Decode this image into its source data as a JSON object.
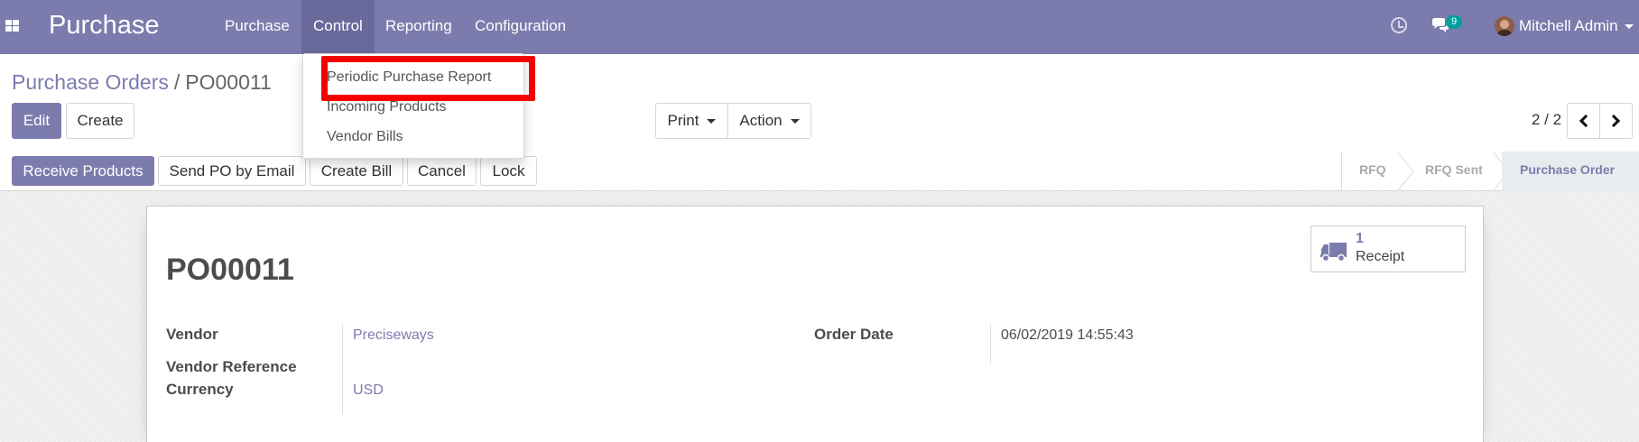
{
  "navbar": {
    "brand": "Purchase",
    "menus": [
      {
        "label": "Purchase",
        "active": false
      },
      {
        "label": "Control",
        "active": true
      },
      {
        "label": "Reporting",
        "active": false
      },
      {
        "label": "Configuration",
        "active": false
      }
    ],
    "chat_count": "9",
    "user_name": "Mitchell Admin",
    "icons": [
      "apps-icon",
      "clock-icon",
      "chat-icon",
      "avatar"
    ]
  },
  "dropdown": {
    "items": [
      "Periodic Purchase Report",
      "Incoming Products",
      "Vendor Bills"
    ],
    "highlighted": "Periodic Purchase Report"
  },
  "breadcrumb": {
    "parent": "Purchase Orders",
    "separator": "/",
    "current": "PO00011"
  },
  "actions": {
    "edit": "Edit",
    "create": "Create",
    "print": "Print",
    "action": "Action"
  },
  "pager": {
    "value": "2 / 2"
  },
  "header_buttons": {
    "receive": "Receive Products",
    "send_email": "Send PO by Email",
    "create_bill": "Create Bill",
    "cancel": "Cancel",
    "lock": "Lock"
  },
  "statusbar": {
    "stages": [
      "RFQ",
      "RFQ Sent",
      "Purchase Order"
    ],
    "active": "Purchase Order"
  },
  "form": {
    "title": "PO00011",
    "smart_button": {
      "value": "1",
      "label": "Receipt",
      "icon": "truck-icon"
    },
    "vendor_label": "Vendor",
    "vendor": "Preciseways",
    "vendor_ref_label": "Vendor Reference",
    "vendor_ref": "",
    "currency_label": "Currency",
    "currency": "USD",
    "order_date_label": "Order Date",
    "order_date": "06/02/2019 14:55:43"
  },
  "colors": {
    "brand": "#7c7bad",
    "highlight": "#f50000",
    "badge": "#00a09d"
  }
}
